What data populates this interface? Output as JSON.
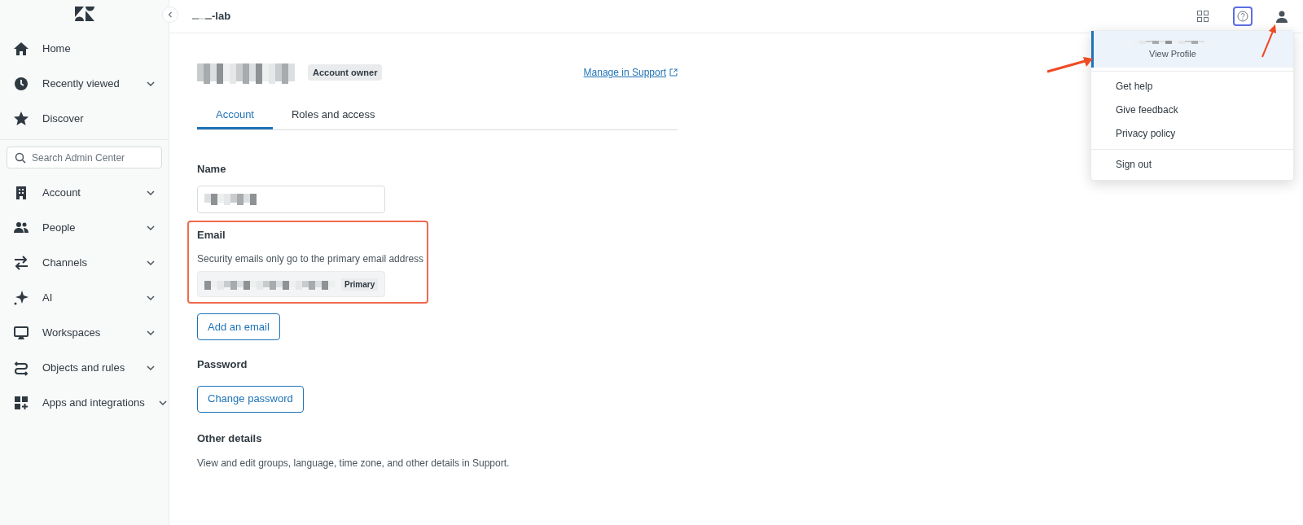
{
  "header": {
    "workspace_suffix": "-lab"
  },
  "sidebar": {
    "items": [
      {
        "label": "Home",
        "expandable": false
      },
      {
        "label": "Recently viewed",
        "expandable": true
      },
      {
        "label": "Discover",
        "expandable": false
      }
    ],
    "search": {
      "placeholder": "Search Admin Center"
    },
    "sections": [
      {
        "label": "Account",
        "expandable": true
      },
      {
        "label": "People",
        "expandable": true
      },
      {
        "label": "Channels",
        "expandable": true
      },
      {
        "label": "AI",
        "expandable": true
      },
      {
        "label": "Workspaces",
        "expandable": true
      },
      {
        "label": "Objects and rules",
        "expandable": true
      },
      {
        "label": "Apps and integrations",
        "expandable": true
      }
    ]
  },
  "profile": {
    "badge": "Account owner",
    "link": "Manage in Support"
  },
  "tabs": [
    {
      "label": "Account",
      "selected": true
    },
    {
      "label": "Roles and access",
      "selected": false
    }
  ],
  "form": {
    "name_label": "Name",
    "email_label": "Email",
    "email_hint": "Security emails only go to the primary email address",
    "email_tag": "Primary",
    "add_email": "Add an email",
    "password_label": "Password",
    "change_password": "Change password",
    "other_label": "Other details",
    "other_text": "View and edit groups, language, time zone, and other details in Support."
  },
  "menu": {
    "profile_link": "View Profile",
    "profile_highlighted": true,
    "items": [
      "Get help",
      "Give feedback",
      "Privacy policy"
    ],
    "sign_out": "Sign out"
  },
  "help_focused": true
}
